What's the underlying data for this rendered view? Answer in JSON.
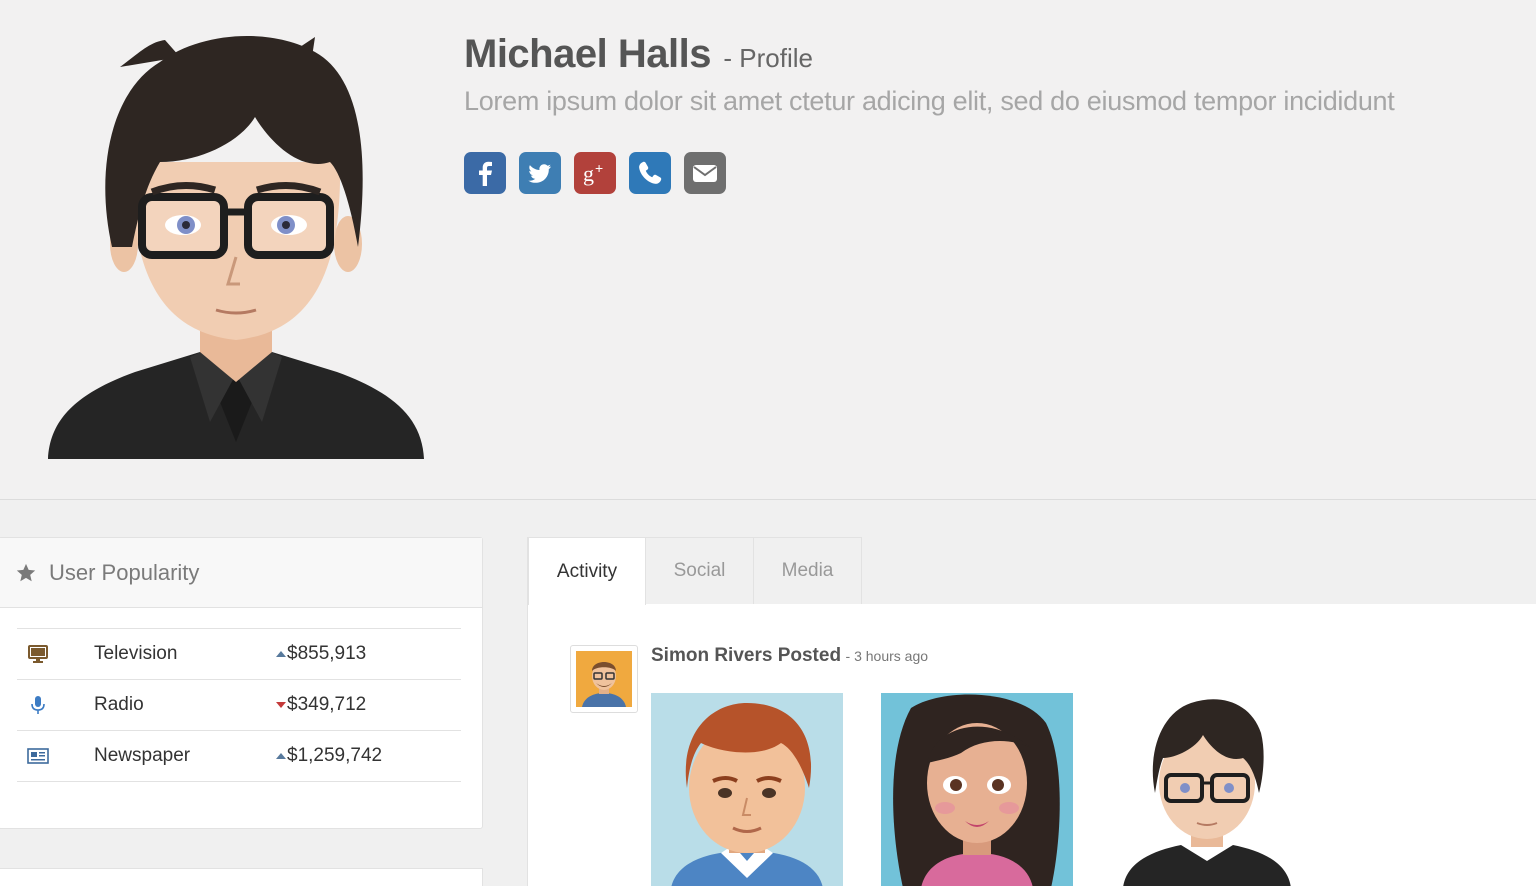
{
  "profile": {
    "name": "Michael Halls",
    "name_suffix": "- Profile",
    "tagline": "Lorem ipsum dolor sit amet ctetur adicing elit, sed do eiusmod tempor incididunt"
  },
  "socials": [
    {
      "icon": "facebook-icon",
      "color": "#3b6aa6"
    },
    {
      "icon": "twitter-icon",
      "color": "#3e7eb3"
    },
    {
      "icon": "google-plus-icon",
      "color": "#b2413b"
    },
    {
      "icon": "phone-icon",
      "color": "#2f79b8"
    },
    {
      "icon": "email-icon",
      "color": "#6f6f6f"
    }
  ],
  "popularity": {
    "title": "User Popularity",
    "rows": [
      {
        "icon": "television-icon",
        "label": "Television",
        "value": "$855,913",
        "trend": "up"
      },
      {
        "icon": "microphone-icon",
        "label": "Radio",
        "value": "$349,712",
        "trend": "down"
      },
      {
        "icon": "newspaper-icon",
        "label": "Newspaper",
        "value": "$1,259,742",
        "trend": "up"
      }
    ]
  },
  "tabs": [
    "Activity",
    "Social",
    "Media"
  ],
  "activity": {
    "author": "Simon Rivers Posted",
    "time": "- 3 hours ago"
  },
  "colors": {
    "header_bg": "#f2f1f1",
    "trend_up": "#57799c",
    "trend_down": "#c43a3a"
  }
}
